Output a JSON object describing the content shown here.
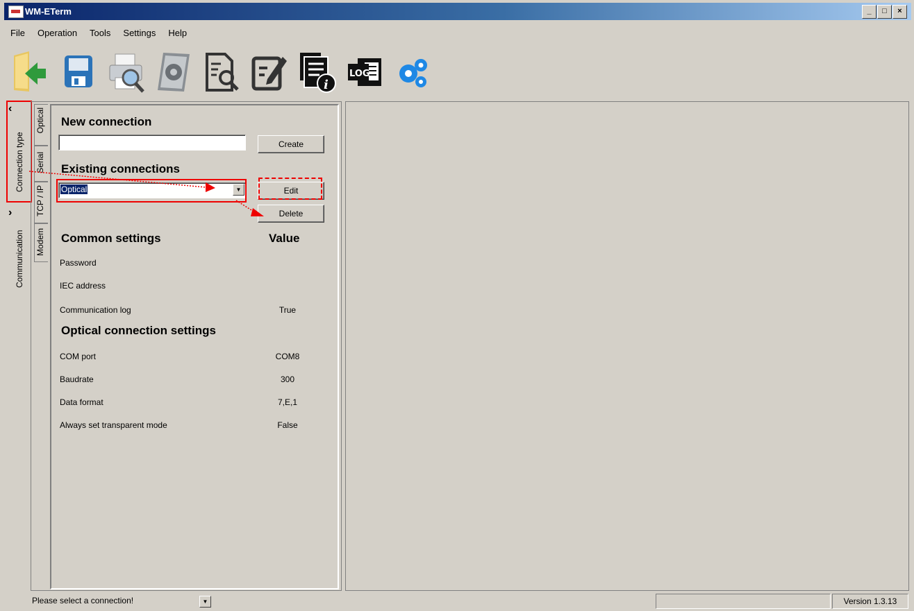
{
  "window": {
    "title": "WM-ETerm",
    "controls": {
      "minimize": "_",
      "maximize": "□",
      "close": "×"
    }
  },
  "menu": [
    "File",
    "Operation",
    "Tools",
    "Settings",
    "Help"
  ],
  "toolbar": [
    {
      "icon": "open-folder-icon"
    },
    {
      "icon": "save-icon"
    },
    {
      "icon": "print-preview-icon"
    },
    {
      "icon": "meter-settings-icon"
    },
    {
      "icon": "document-search-icon"
    },
    {
      "icon": "edit-document-icon"
    },
    {
      "icon": "document-info-icon"
    },
    {
      "icon": "log-icon",
      "label": "LOG"
    },
    {
      "icon": "gears-icon"
    }
  ],
  "side_tabs": {
    "connection_type": "Connection type",
    "communication": "Communication"
  },
  "connection_tabs": [
    "Optical",
    "Serial",
    "TCP / IP",
    "Modem"
  ],
  "panel": {
    "new_connection_heading": "New connection",
    "new_connection_value": "",
    "create_button": "Create",
    "existing_heading": "Existing connections",
    "existing_selected": "Optical",
    "edit_button": "Edit",
    "delete_button": "Delete",
    "common_heading": "Common settings",
    "value_heading": "Value",
    "common_rows": [
      {
        "label": "Password",
        "value": ""
      },
      {
        "label": "IEC address",
        "value": ""
      },
      {
        "label": "Communication log",
        "value": "True"
      }
    ],
    "optical_heading": "Optical connection settings",
    "optical_rows": [
      {
        "label": "COM port",
        "value": "COM8"
      },
      {
        "label": "Baudrate",
        "value": "300"
      },
      {
        "label": "Data format",
        "value": "7,E,1"
      },
      {
        "label": "Always set transparent mode",
        "value": "False"
      }
    ]
  },
  "status": {
    "message": "Please select a connection!",
    "version": "Version 1.3.13"
  },
  "colors": {
    "annotation_red": "#e00000",
    "selection": "#0a246a",
    "face": "#d4d0c8"
  }
}
